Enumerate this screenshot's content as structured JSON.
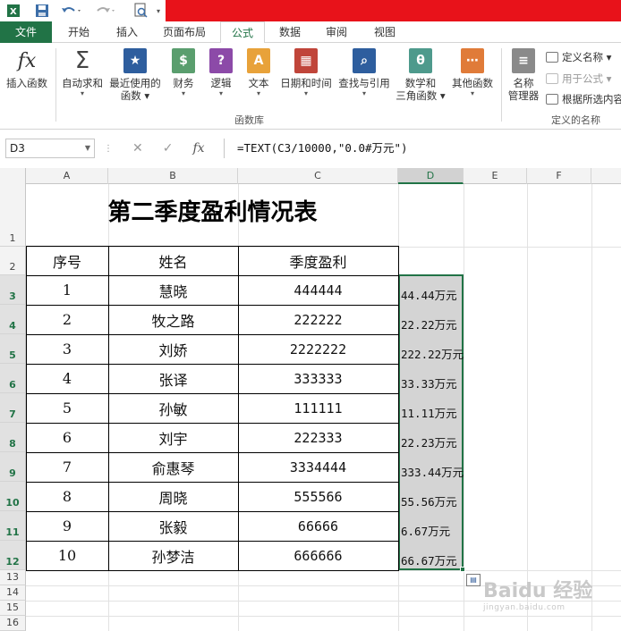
{
  "tabs": [
    "文件",
    "开始",
    "插入",
    "页面布局",
    "公式",
    "数据",
    "审阅",
    "视图"
  ],
  "ribbon": {
    "buttons": [
      {
        "icon": "fx-icon",
        "label": "插入函数",
        "caret": ""
      },
      {
        "icon": "sigma-icon",
        "label": "自动求和",
        "caret": "▾"
      },
      {
        "icon": "star-icon",
        "label": "最近使用的",
        "label2": "函数 ▾"
      },
      {
        "icon": "finance-icon",
        "label": "财务",
        "caret": "▾"
      },
      {
        "icon": "logic-icon",
        "label": "逻辑",
        "caret": "▾"
      },
      {
        "icon": "text-icon",
        "label": "文本",
        "caret": "▾"
      },
      {
        "icon": "calendar-icon",
        "label": "日期和时间",
        "caret": "▾"
      },
      {
        "icon": "lookup-icon",
        "label": "查找与引用",
        "caret": "▾"
      },
      {
        "icon": "math-icon",
        "label": "数学和",
        "label2": "三角函数 ▾"
      },
      {
        "icon": "more-functions-icon",
        "label": "其他函数",
        "caret": "▾"
      },
      {
        "icon": "name-manager-icon",
        "label": "名称",
        "label2": "管理器"
      }
    ],
    "group_function_library": "函数库",
    "group_defined_names": "定义的名称",
    "define_name": "定义名称 ▾",
    "use_in_formula": "用于公式 ▾",
    "create_from_selection": "根据所选内容"
  },
  "formula_bar": {
    "name_box": "D3",
    "cancel": "✕",
    "enter": "✓",
    "fx": "fx",
    "formula": "=TEXT(C3/10000,\"0.0#万元\")"
  },
  "columns": [
    "A",
    "B",
    "C",
    "D",
    "E",
    "F"
  ],
  "rows": [
    "1",
    "2",
    "3",
    "4",
    "5",
    "6",
    "7",
    "8",
    "9",
    "10",
    "11",
    "12",
    "13",
    "14",
    "15",
    "16"
  ],
  "sheet": {
    "title": "第二季度盈利情况表",
    "headers": [
      "序号",
      "姓名",
      "季度盈利"
    ],
    "data": [
      {
        "no": "1",
        "name": "慧晓",
        "profit": "444444",
        "result": "44.44万元"
      },
      {
        "no": "2",
        "name": "牧之路",
        "profit": "222222",
        "result": "22.22万元"
      },
      {
        "no": "3",
        "name": "刘娇",
        "profit": "2222222",
        "result": "222.22万元"
      },
      {
        "no": "4",
        "name": "张译",
        "profit": "333333",
        "result": "33.33万元"
      },
      {
        "no": "5",
        "name": "孙敏",
        "profit": "111111",
        "result": "11.11万元"
      },
      {
        "no": "6",
        "name": "刘宇",
        "profit": "222333",
        "result": "22.23万元"
      },
      {
        "no": "7",
        "name": "俞惠琴",
        "profit": "3334444",
        "result": "333.44万元"
      },
      {
        "no": "8",
        "name": "周晓",
        "profit": "555566",
        "result": "55.56万元"
      },
      {
        "no": "9",
        "name": "张毅",
        "profit": "66666",
        "result": "6.67万元"
      },
      {
        "no": "10",
        "name": "孙梦洁",
        "profit": "666666",
        "result": "66.67万元"
      }
    ]
  },
  "watermark": {
    "main": "Baidu 经验",
    "sub": "jingyan.baidu.com"
  },
  "colors": {
    "excel_green": "#217346",
    "title_bar": "#e8121a"
  }
}
